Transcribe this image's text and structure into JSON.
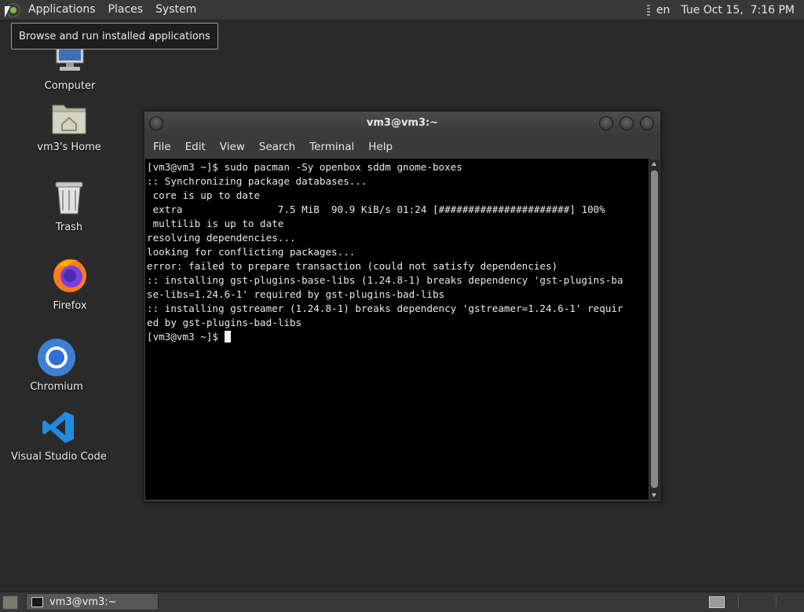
{
  "top_panel": {
    "menus": [
      "Applications",
      "Places",
      "System"
    ],
    "keyboard_layout": "en",
    "clock": "Tue Oct 15,  7:16 PM"
  },
  "tooltip": "Browse and run installed applications",
  "desktop_icons": [
    {
      "label": "Computer",
      "icon": "computer-icon"
    },
    {
      "label": "vm3's Home",
      "icon": "home-folder-icon"
    },
    {
      "label": "Trash",
      "icon": "trash-icon"
    },
    {
      "label": "Firefox",
      "icon": "firefox-icon"
    },
    {
      "label": "Chromium",
      "icon": "chromium-icon"
    },
    {
      "label": "Visual Studio Code",
      "icon": "vscode-icon"
    }
  ],
  "terminal": {
    "title": "vm3@vm3:~",
    "menu": [
      "File",
      "Edit",
      "View",
      "Search",
      "Terminal",
      "Help"
    ],
    "lines": [
      "[vm3@vm3 ~]$ sudo pacman -Sy openbox sddm gnome-boxes",
      ":: Synchronizing package databases...",
      " core is up to date",
      " extra                7.5 MiB  90.9 KiB/s 01:24 [######################] 100%",
      " multilib is up to date",
      "resolving dependencies...",
      "looking for conflicting packages...",
      "error: failed to prepare transaction (could not satisfy dependencies)",
      ":: installing gst-plugins-base-libs (1.24.8-1) breaks dependency 'gst-plugins-ba",
      "se-libs=1.24.6-1' required by gst-plugins-bad-libs",
      ":: installing gstreamer (1.24.8-1) breaks dependency 'gstreamer=1.24.6-1' requir",
      "ed by gst-plugins-bad-libs",
      "[vm3@vm3 ~]$ "
    ]
  },
  "taskbar": {
    "window_button": "vm3@vm3:~"
  }
}
